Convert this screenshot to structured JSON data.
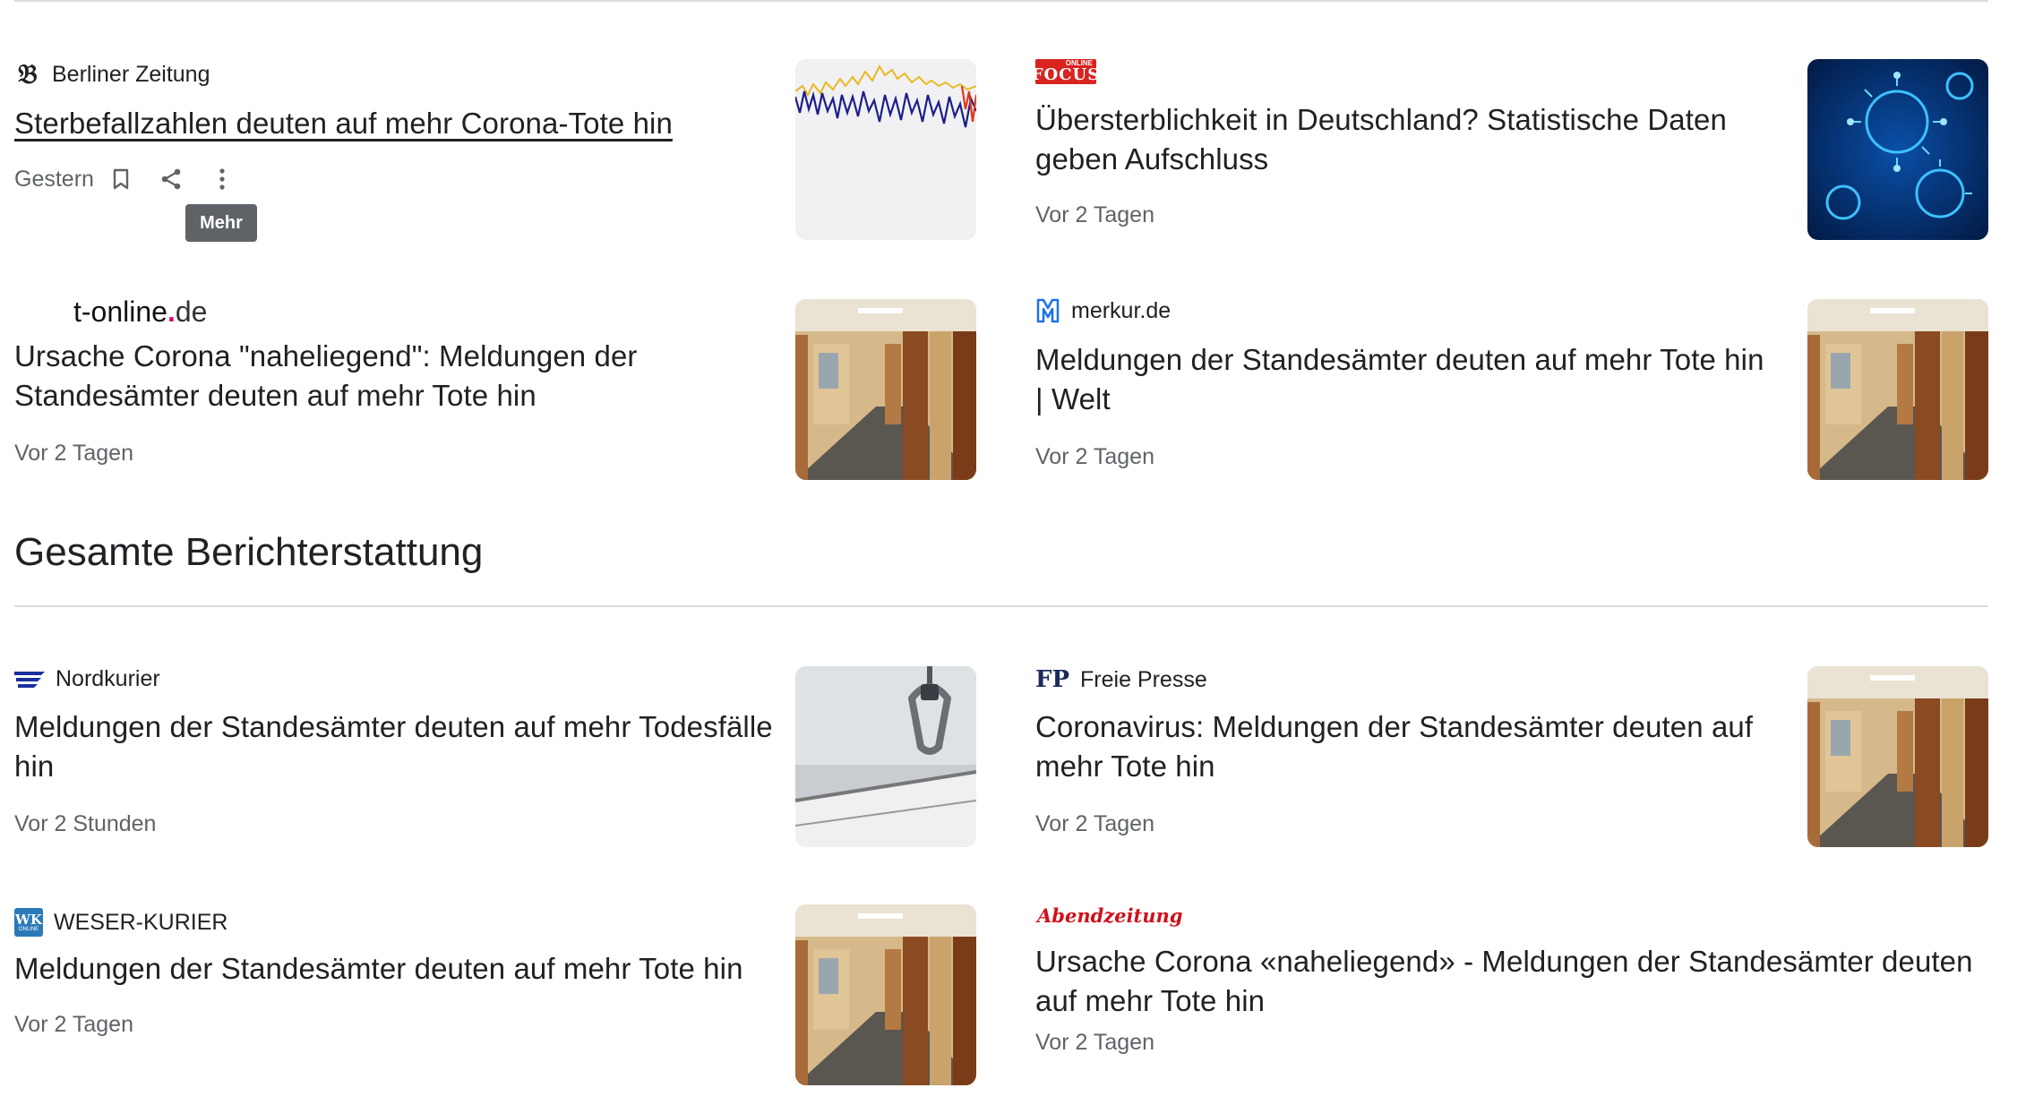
{
  "articles": [
    {
      "source": "Berliner Zeitung",
      "title": "Sterbefallzahlen deuten auf mehr Corona-Tote hin",
      "time": "Gestern",
      "thumb": "chart-image"
    },
    {
      "source": "FOCUS ONLINE",
      "title": "Übersterblichkeit in Deutschland? Statistische Daten geben Aufschluss",
      "time": "Vor 2 Tagen",
      "thumb": "virus-image"
    },
    {
      "source": "t-online.de",
      "source_main": "t-online",
      "source_dot": ".",
      "source_tld": "de",
      "title": "Ursache Corona \"naheliegend\": Meldungen der Standesämter deuten auf mehr Tote hin",
      "time": "Vor 2 Tagen",
      "thumb": "coffin-room-image"
    },
    {
      "source": "merkur.de",
      "title": "Meldungen der Standesämter deuten auf mehr Tote hin | Welt",
      "time": "Vor 2 Tagen",
      "thumb": "coffin-room-image"
    }
  ],
  "section": {
    "title": "Gesamte Berichterstattung"
  },
  "coverage": [
    {
      "source": "Nordkurier",
      "title": "Meldungen der Standesämter deuten auf mehr Todesfälle hin",
      "time": "Vor 2 Stunden",
      "thumb": "hospital-bed-image"
    },
    {
      "source": "Freie Presse",
      "title": "Coronavirus: Meldungen der Standesämter deuten auf mehr Tote hin",
      "time": "Vor 2 Tagen",
      "thumb": "coffin-room-image"
    },
    {
      "source": "WESER-KURIER",
      "title": "Meldungen der Standesämter deuten auf mehr Tote hin",
      "time": "Vor 2 Tagen",
      "thumb": "coffin-room-image"
    },
    {
      "source": "Abendzeitung",
      "title": "Ursache Corona «naheliegend» - Meldungen der Standesämter deuten auf mehr Tote hin",
      "time": "Vor 2 Tagen",
      "thumb": "coffin-room-image"
    }
  ],
  "actions": {
    "bookmark_icon": "bookmark-icon",
    "share_icon": "share-icon",
    "more_icon": "more-vert-icon",
    "tooltip": "Mehr"
  },
  "logos": {
    "focus_small": "ONLINE",
    "focus_main": "FOCUS",
    "freie_presse": "FP",
    "weser_kurier_main": "WK",
    "weser_kurier_small": "ONLINE",
    "abendzeitung": "Abendzeitung"
  },
  "colors": {
    "text": "#202124",
    "secondary": "#5f6368",
    "divider": "#dadce0",
    "focus_red": "#d8231f",
    "merkur_blue": "#1a73e8",
    "nordkurier_blue": "#1c2f9e",
    "abendzeitung_red": "#d0101b"
  }
}
